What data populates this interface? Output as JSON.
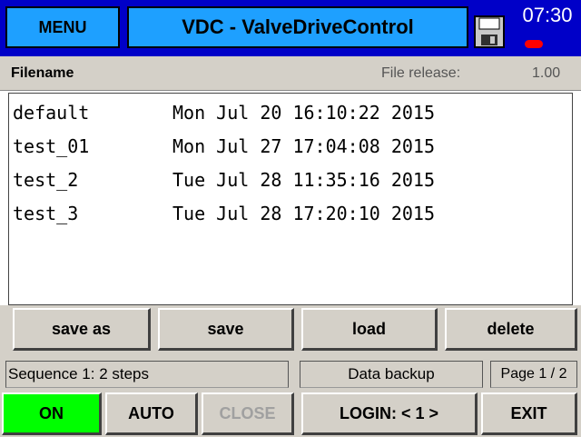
{
  "header": {
    "menu_label": "MENU",
    "title": "VDC - ValveDriveControl",
    "time": "07:30",
    "save_icon": "floppy-disk-icon",
    "status_led_color": "#ff0000"
  },
  "file_header": {
    "filename_label": "Filename",
    "release_label": "File release:",
    "release_value": "1.00"
  },
  "files": [
    {
      "name": "default",
      "date": "Mon Jul 20 16:10:22 2015"
    },
    {
      "name": "test_01",
      "date": "Mon Jul 27 17:04:08 2015"
    },
    {
      "name": "test_2",
      "date": "Tue Jul 28 11:35:16 2015"
    },
    {
      "name": "test_3",
      "date": "Tue Jul 28 17:20:10 2015"
    }
  ],
  "actions": {
    "save_as": "save as",
    "save": "save",
    "load": "load",
    "delete": "delete"
  },
  "status": {
    "sequence": "Sequence 1: 2 steps",
    "backup": "Data backup",
    "page": "Page 1 / 2"
  },
  "bottom": {
    "on": "ON",
    "auto": "AUTO",
    "close": "CLOSE",
    "login": "LOGIN: < 1 >",
    "exit": "EXIT"
  },
  "colors": {
    "topbar": "#0000c8",
    "accent": "#1ea0ff",
    "on_green": "#00ff00",
    "panel_gray": "#d4d0c8"
  }
}
